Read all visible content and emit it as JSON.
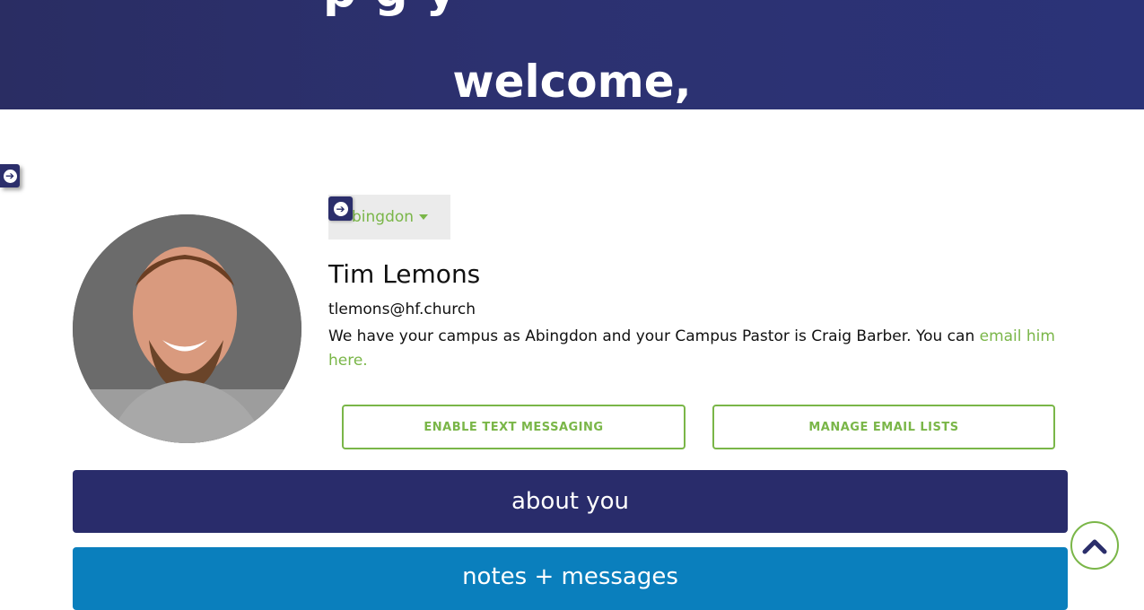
{
  "hero": {
    "cut_text": "p g y",
    "welcome": "welcome,"
  },
  "profile": {
    "campus": "Abingdon",
    "campus_partial": "bingdon",
    "name": "Tim Lemons",
    "email": "tlemons@hf.church",
    "info_text": "We have your campus as Abingdon and your Campus Pastor is Craig Barber. You can ",
    "info_link": "email him here."
  },
  "actions": {
    "text_messaging": "ENABLE TEXT MESSAGING",
    "email_lists": "MANAGE EMAIL LISTS"
  },
  "panels": {
    "about": "about you",
    "notes": "notes + messages"
  },
  "icons": {
    "side": "arrow-right-circle-icon",
    "dropdown": "arrow-right-circle-icon",
    "scroll": "chevron-up-icon"
  },
  "colors": {
    "accent": "#7ab648",
    "navy": "#292c6b",
    "blue": "#0a7fbd"
  }
}
